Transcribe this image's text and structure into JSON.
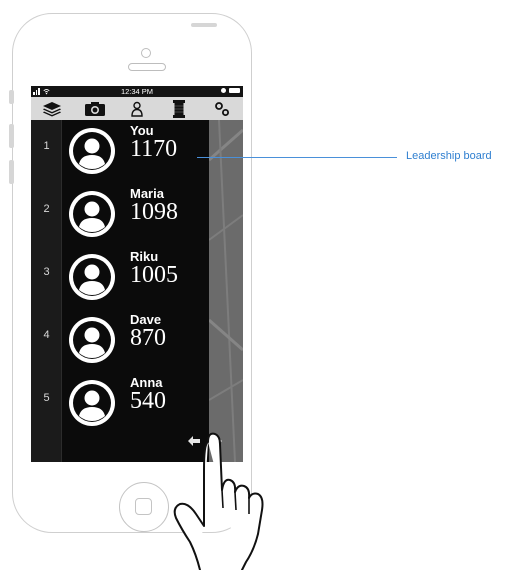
{
  "status_bar": {
    "time": "12:34 PM"
  },
  "toolbar": {
    "items": [
      {
        "icon": "layers-icon"
      },
      {
        "icon": "camera-icon"
      },
      {
        "icon": "person-icon"
      },
      {
        "icon": "film-roll-icon"
      },
      {
        "icon": "settings-icon"
      }
    ]
  },
  "leaderboard": {
    "entries": [
      {
        "rank": "1",
        "name": "You",
        "score": "1170"
      },
      {
        "rank": "2",
        "name": "Maria",
        "score": "1098"
      },
      {
        "rank": "3",
        "name": "Riku",
        "score": "1005"
      },
      {
        "rank": "4",
        "name": "Dave",
        "score": "870"
      },
      {
        "rank": "5",
        "name": "Anna",
        "score": "540"
      }
    ]
  },
  "annotation": {
    "label": "Leadership board",
    "color": "#2f7fd0"
  },
  "colors": {
    "screen_bg": "#141414",
    "toolbar_bg": "#d9d9d9",
    "map_bg": "#6b6b6b"
  }
}
